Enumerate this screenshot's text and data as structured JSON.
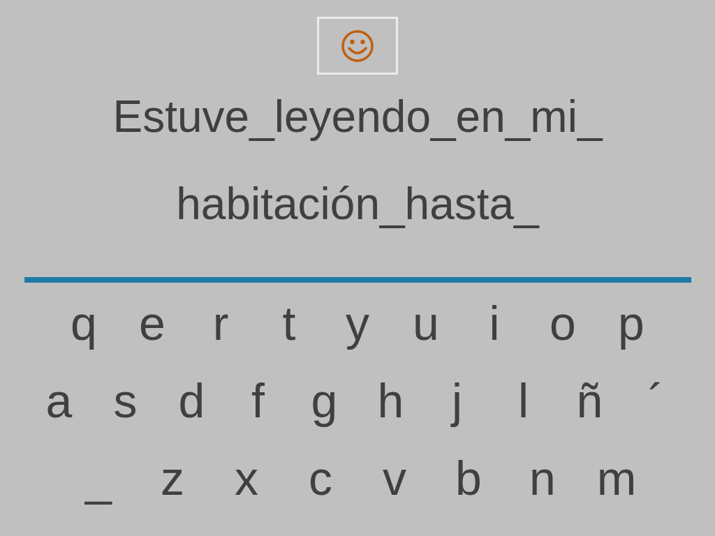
{
  "sentence_lines": [
    "Estuve_leyendo_en_mi_",
    "habitación_hasta_"
  ],
  "keyboard": {
    "rows": [
      {
        "keys": [
          "q",
          "e",
          "r",
          "t",
          "y",
          "u",
          "i",
          "o",
          "p"
        ]
      },
      {
        "keys": [
          "a",
          "s",
          "d",
          "f",
          "g",
          "h",
          "j",
          "l",
          "ñ",
          "´"
        ]
      },
      {
        "keys": [
          "_",
          "z",
          "x",
          "c",
          "v",
          "b",
          "n",
          "m"
        ]
      }
    ]
  }
}
